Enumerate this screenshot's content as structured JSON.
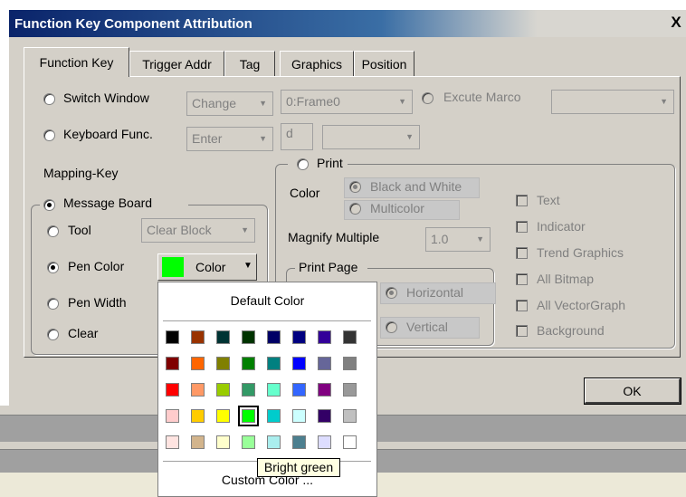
{
  "window": {
    "title": "Function Key Component Attribution",
    "close_glyph": "X"
  },
  "tabs": [
    {
      "label": "Function Key",
      "active": true
    },
    {
      "label": "Trigger Addr"
    },
    {
      "label": "Tag"
    },
    {
      "label": "Graphics"
    },
    {
      "label": "Position"
    }
  ],
  "function": {
    "switch_window_label": "Switch Window",
    "switch_window_action": "Change",
    "switch_window_frame": "0:Frame0",
    "execute_macro_label": "Excute Marco",
    "execute_macro_value": "",
    "keyboard_label": "Keyboard Func.",
    "keyboard_key": "Enter",
    "keyboard_char": "d",
    "keyboard_extra": ""
  },
  "mapping": {
    "heading": "Mapping-Key",
    "message_board_label": "Message Board",
    "tool_label": "Tool",
    "tool_value": "Clear Block",
    "pen_color_label": "Pen Color",
    "pen_color_value": "#00ff00",
    "pen_color_button": "Color",
    "pen_width_label": "Pen Width",
    "clear_label": "Clear"
  },
  "print": {
    "label": "Print",
    "color_label": "Color",
    "bw_label": "Black and White",
    "multicolor_label": "Multicolor",
    "magnify_label": "Magnify Multiple",
    "magnify_value": "1.0",
    "page_label": "Print Page",
    "horizontal_label": "Horizontal",
    "vertical_label": "Vertical",
    "options": [
      "Text",
      "Indicator",
      "Trend Graphics",
      "All Bitmap",
      "All VectorGraph",
      "Background"
    ]
  },
  "buttons": {
    "ok": "OK"
  },
  "color_picker": {
    "default_label": "Default Color",
    "custom_label": "Custom Color ...",
    "selected": "#00ff00",
    "rows": [
      [
        "#000000",
        "#993300",
        "#003333",
        "#003300",
        "#000066",
        "#000080",
        "#330099",
        "#333333"
      ],
      [
        "#800000",
        "#ff6600",
        "#808000",
        "#008000",
        "#008080",
        "#0000ff",
        "#666699",
        "#808080"
      ],
      [
        "#ff0000",
        "#ff9966",
        "#99cc00",
        "#339966",
        "#66ffcc",
        "#3366ff",
        "#800080",
        "#999999"
      ],
      [
        "#ffcccc",
        "#ffcc00",
        "#ffff00",
        "#00ff00",
        "#00cccc",
        "#ccffff",
        "#330066",
        "#c0c0c0"
      ],
      [
        "#ffe4e1",
        "#d2b48c",
        "#ffffcc",
        "#99ff99",
        "#aaeeee",
        "#4c7f8f",
        "#ddddff",
        "#ffffff"
      ]
    ],
    "tooltip": "Bright green"
  }
}
